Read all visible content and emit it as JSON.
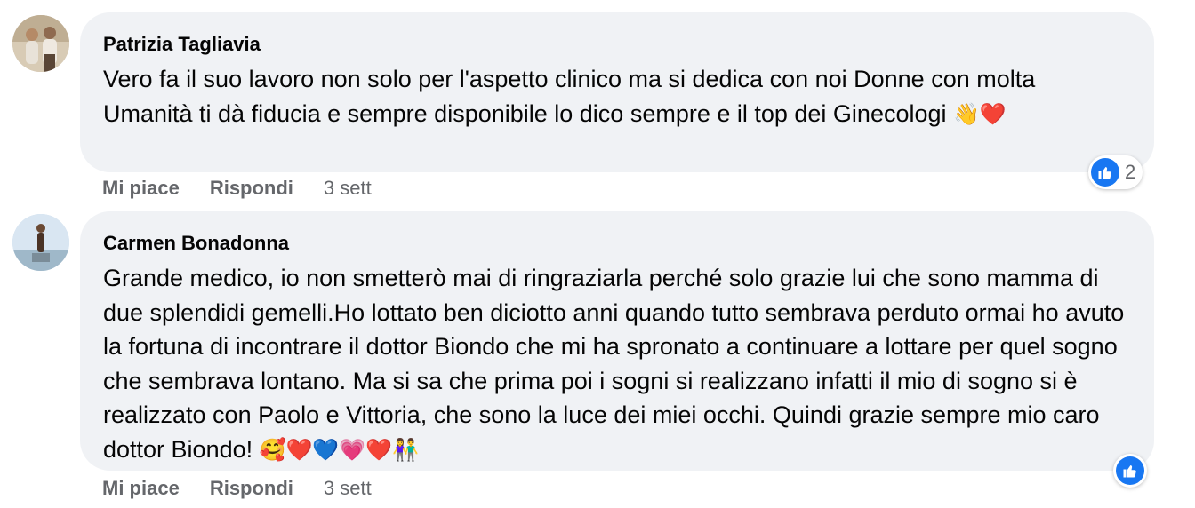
{
  "comments": [
    {
      "author": "Patrizia Tagliavia",
      "text": "Vero fa il suo lavoro non solo per l'aspetto clinico ma si dedica con noi Donne con molta Umanità ti dà fiducia e sempre disponibile lo dico sempre e il top dei Ginecologi",
      "emojis": [
        "👋",
        "❤️"
      ],
      "like_label": "Mi piace",
      "reply_label": "Rispondi",
      "time": "3 sett",
      "reaction_count": "2",
      "reaction_icon": "like-icon"
    },
    {
      "author": "Carmen Bonadonna",
      "text": "Grande medico, io non smetterò mai di ringraziarla perché solo grazie lui che sono mamma di due splendidi gemelli.Ho lottato ben diciotto anni quando tutto sembrava perduto ormai ho avuto la fortuna di incontrare il dottor Biondo che mi ha spronato a continuare a lottare per quel sogno che sembrava lontano. Ma si sa che prima poi i sogni si realizzano infatti il mio di sogno si è realizzato con Paolo e Vittoria, che sono la luce dei miei occhi. Quindi grazie sempre mio caro dottor Biondo!",
      "emojis": [
        "🥰",
        "❤️",
        "💙",
        "💗",
        "❤️",
        "👫"
      ],
      "like_label": "Mi piace",
      "reply_label": "Rispondi",
      "time": "3 sett",
      "reaction_icon": "like-icon"
    }
  ],
  "colors": {
    "bubble": "#f0f2f5",
    "meta": "#65676b",
    "like": "#1877f2"
  }
}
